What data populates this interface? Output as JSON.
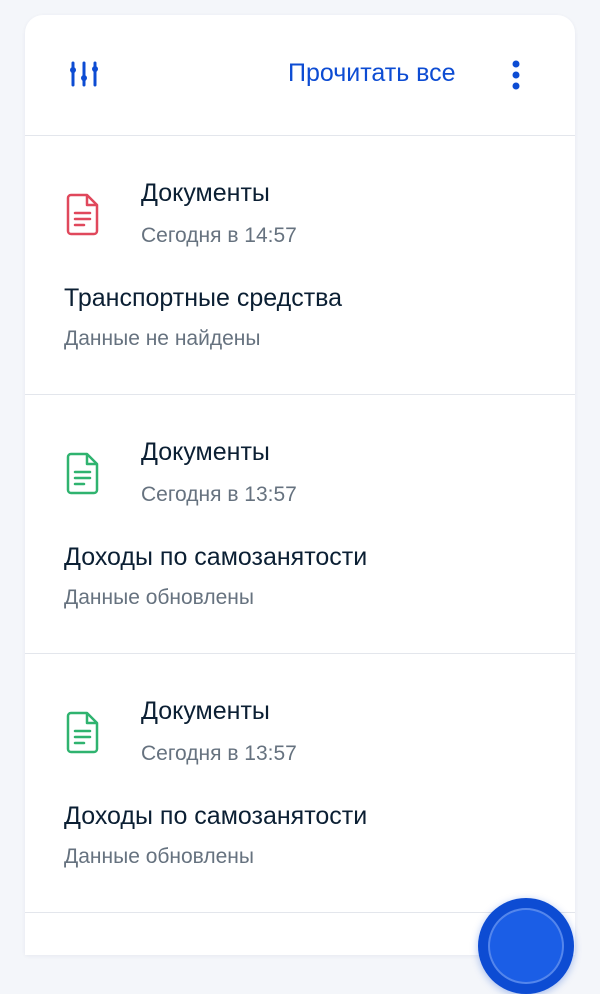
{
  "header": {
    "filter_icon": "sliders-icon",
    "read_all_label": "Прочитать все",
    "menu_icon": "kebab-menu-icon"
  },
  "notifications": [
    {
      "category": "Документы",
      "time": "Сегодня в 14:57",
      "title": "Транспортные средства",
      "status": "Данные не найдены",
      "icon": "document-icon",
      "icon_color": "#e0485c"
    },
    {
      "category": "Документы",
      "time": "Сегодня в 13:57",
      "title": "Доходы по самозанятости",
      "status": "Данные обновлены",
      "icon": "document-icon",
      "icon_color": "#2fb36f"
    },
    {
      "category": "Документы",
      "time": "Сегодня в 13:57",
      "title": "Доходы по самозанятости",
      "status": "Данные обновлены",
      "icon": "document-icon",
      "icon_color": "#2fb36f"
    }
  ],
  "colors": {
    "accent": "#0d4cd3",
    "text_primary": "#0b1f33",
    "text_secondary": "#66727f"
  }
}
